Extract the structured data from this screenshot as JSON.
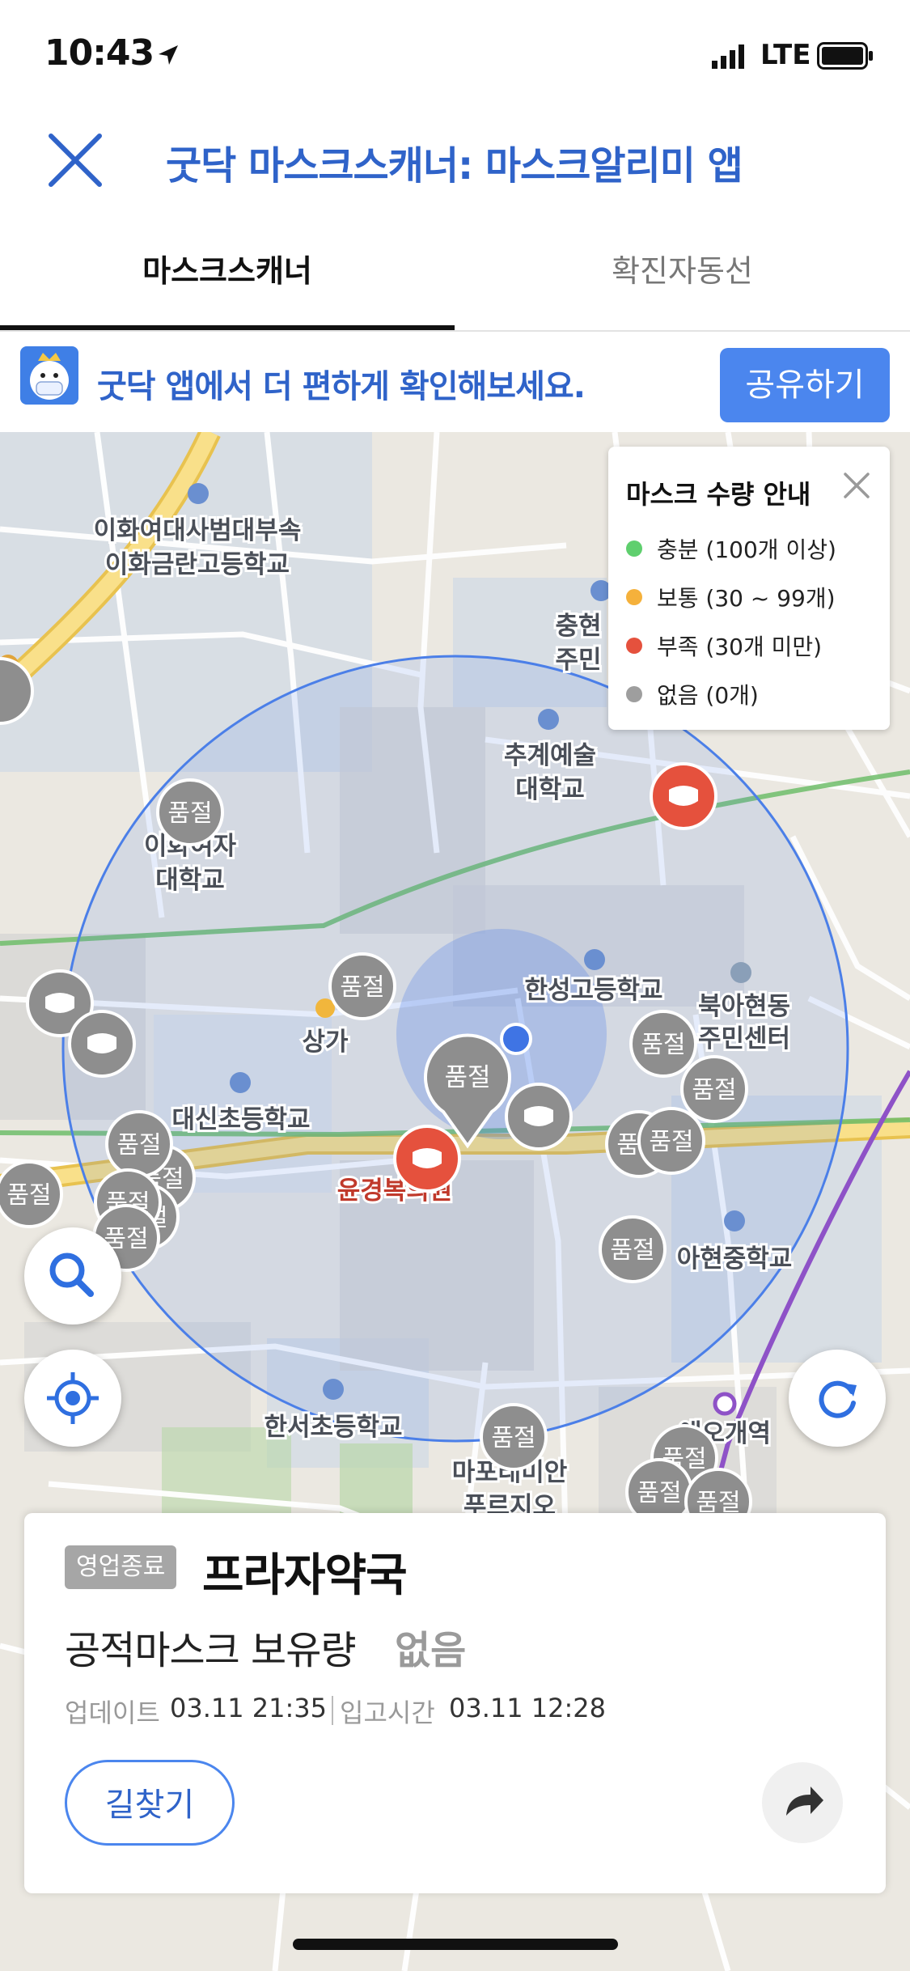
{
  "status_bar": {
    "time": "10:43",
    "network": "LTE"
  },
  "header": {
    "title": "굿닥 마스크스캐너: 마스크알리미 앱"
  },
  "tabs": [
    {
      "label": "마스크스캐너",
      "active": true
    },
    {
      "label": "확진자동선",
      "active": false
    }
  ],
  "banner": {
    "text": "굿닥 앱에서 더 편하게 확인해보세요.",
    "share_label": "공유하기"
  },
  "legend": {
    "title": "마스크 수량 안내",
    "items": [
      {
        "label": "충분 (100개 이상)",
        "color": "#5fcf6e"
      },
      {
        "label": "보통 (30 ~ 99개)",
        "color": "#f5b13b"
      },
      {
        "label": "부족 (30개 미만)",
        "color": "#e5513d"
      },
      {
        "label": "없음 (0개)",
        "color": "#9e9e9e"
      }
    ]
  },
  "map": {
    "place_labels": [
      "이화여대사범대부속",
      "이화금란고등학교",
      "추계예술",
      "대학교",
      "이화여자",
      "대학교",
      "한성고등학교",
      "북아현동",
      "주민센터",
      "상가",
      "대신초등학교",
      "윤경복의원",
      "아현중학교",
      "한서초등학교",
      "애오개역",
      "마포래미안",
      "푸르지오",
      "충현",
      "주민"
    ],
    "soldout_label": "품절",
    "colors": {
      "soldout": "#8e8e8e",
      "low": "#e5513d",
      "circle": "#4b7fe8",
      "green_line": "#6fbd6a",
      "purple_line": "#8e52c7",
      "road_main": "#f6d96b"
    }
  },
  "card": {
    "status_badge": "영업종료",
    "pharmacy_name": "프라자약국",
    "stock_label": "공적마스크 보유량",
    "stock_value": "없음",
    "updated_label": "업데이트",
    "updated_value": "03.11 21:35",
    "stocked_label": "입고시간",
    "stocked_value": "03.11 12:28",
    "directions_label": "길찾기"
  }
}
